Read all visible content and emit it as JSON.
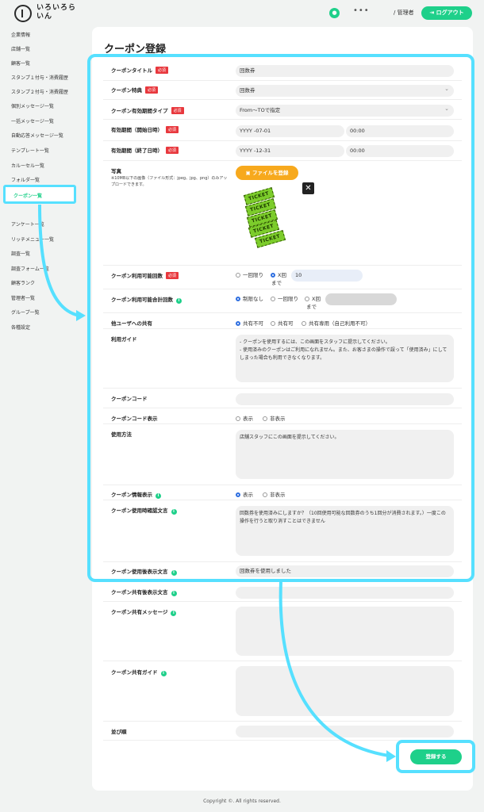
{
  "header": {
    "logo_text": "いろいろらいん",
    "user_icon": "user-icon",
    "more": "•••",
    "admin_label": "/ 管理者",
    "logout_label": "ログアウト"
  },
  "sidebar": {
    "items": [
      {
        "label": "企業情報"
      },
      {
        "label": "店舗一覧"
      },
      {
        "label": "顧客一覧"
      },
      {
        "label": "スタンプ１付与・消費履歴"
      },
      {
        "label": "スタンプ２付与・消費履歴"
      },
      {
        "label": "個別メッセージ一覧"
      },
      {
        "label": "一括メッセージ一覧"
      },
      {
        "label": "自動応答メッセージ一覧"
      },
      {
        "label": "テンプレート一覧"
      },
      {
        "label": "カルーセル一覧"
      },
      {
        "label": "フォルダ一覧"
      },
      {
        "label": "クーポン一覧",
        "active": true
      },
      {
        "label": "アンケート一覧"
      },
      {
        "label": "リッチメニュー一覧"
      },
      {
        "label": "調査一覧"
      },
      {
        "label": "調査フォーム一覧"
      },
      {
        "label": "顧客ランク"
      },
      {
        "label": "管理者一覧"
      },
      {
        "label": "グループ一覧"
      },
      {
        "label": "各種設定"
      }
    ]
  },
  "page": {
    "title": "クーポン登録"
  },
  "badges": {
    "required": "必須"
  },
  "form": {
    "coupon_title": {
      "label": "クーポンタイトル",
      "value": "回数券"
    },
    "coupon_benefit": {
      "label": "クーポン特典",
      "value": "回数券"
    },
    "period_type": {
      "label": "クーポン有効期間タイプ",
      "value": "From〜TOで指定"
    },
    "start": {
      "label": "有効期間（開始日時）",
      "date": "YYYY -07-01",
      "time": "00:00"
    },
    "end": {
      "label": "有効期間（終了日時）",
      "date": "YYYY -12-31",
      "time": "00:00"
    },
    "photo": {
      "label": "写真",
      "note": "※10MB以下の画像（ファイル形式：jpeg、jpg、png）のみアップロードできます。",
      "button": "ファイルを登録",
      "ticket_text": "TICKET",
      "close": "✕"
    },
    "usable_count": {
      "label": "クーポン利用可能回数",
      "opt1": "一回限り",
      "opt2": "X回",
      "opt2_suffix": "まで",
      "value": "10"
    },
    "total_count": {
      "label": "クーポン利用可能合計回数",
      "opt1": "制限なし",
      "opt2": "一回限り",
      "opt3": "X回",
      "opt3_suffix": "まで"
    },
    "share": {
      "label": "他ユーザへの共有",
      "opt1": "共有不可",
      "opt2": "共有可",
      "opt3": "共有専用（自己利用不可）"
    },
    "guide": {
      "label": "利用ガイド",
      "value": "- クーポンを使用するには、この画面をスタッフに提示してください。\n- 使用済みのクーポンはご利用になれません。また、お客さまの操作で誤って「使用済み」にしてしまった場合も利用できなくなります。"
    },
    "code": {
      "label": "クーポンコード",
      "value": ""
    },
    "code_display": {
      "label": "クーポンコード表示",
      "opt1": "表示",
      "opt2": "非表示"
    },
    "usage": {
      "label": "使用方法",
      "value": "店舗スタッフにこの画面を提示してください。"
    },
    "info_display": {
      "label": "クーポン情報表示",
      "opt1": "表示",
      "opt2": "非表示"
    },
    "confirm_text": {
      "label": "クーポン使用時確認文言",
      "value": "回数券を使用済みにしますか？（10回使用可能な回数券のうち1回分が消費されます。）一度この操作を行うと取り消すことはできません"
    },
    "after_use_text": {
      "label": "クーポン使用後表示文言",
      "value": "回数券を使用しました"
    },
    "after_share_text": {
      "label": "クーポン共有後表示文言",
      "value": ""
    },
    "share_message": {
      "label": "クーポン共有メッセージ",
      "value": ""
    },
    "share_guide": {
      "label": "クーポン共有ガイド",
      "value": ""
    },
    "order": {
      "label": "並び順",
      "value": ""
    }
  },
  "submit_label": "登録する",
  "footer": "Copyright ©. All rights reserved.",
  "colors": {
    "accent": "#1ed08a",
    "highlight": "#56e0ff",
    "required": "#e8383d",
    "file_button": "#f7a91d"
  }
}
